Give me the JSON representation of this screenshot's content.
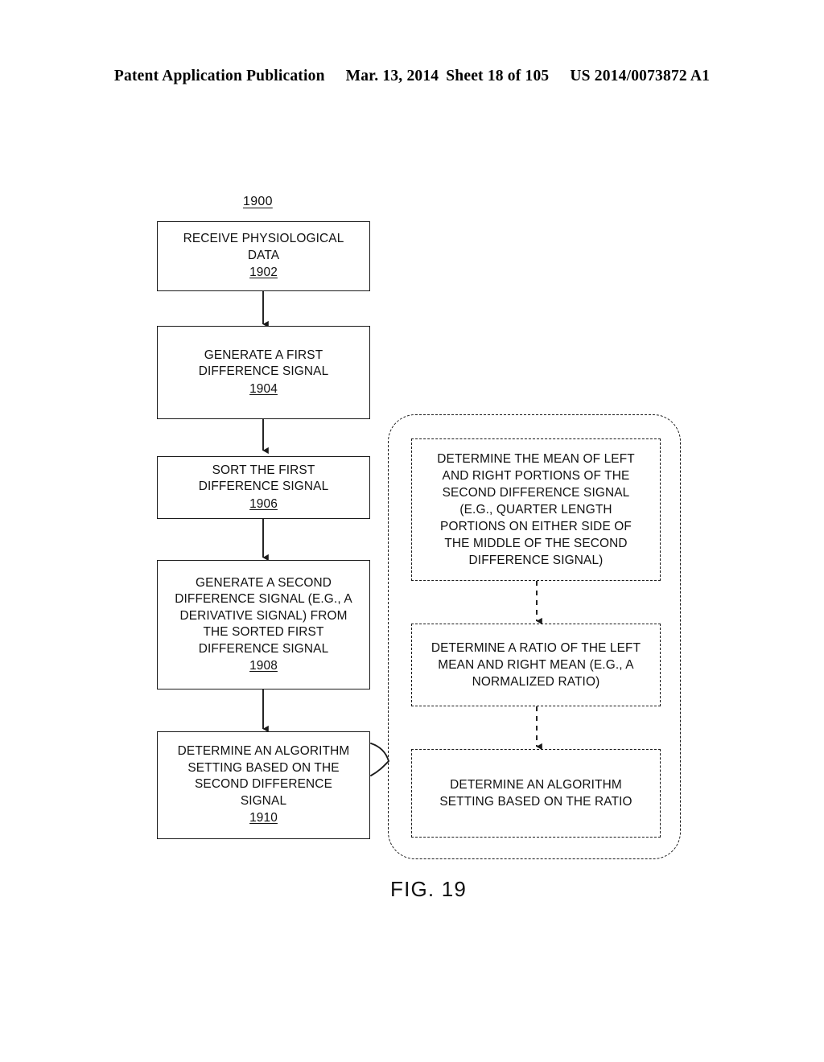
{
  "header": {
    "publication": "Patent Application Publication",
    "date": "Mar. 13, 2014",
    "sheet": "Sheet 18 of 105",
    "patent_number": "US 2014/0073872 A1"
  },
  "figure": {
    "caption": "FIG. 19",
    "diagram_ref": "1900",
    "type": "flowchart",
    "colors": {
      "line": "#1a1a1a",
      "text": "#111111",
      "background": "#ffffff"
    },
    "main_flow": [
      {
        "id": "1902",
        "text": "RECEIVE PHYSIOLOGICAL\nDATA",
        "ref": "1902"
      },
      {
        "id": "1904",
        "text": "GENERATE A FIRST\nDIFFERENCE SIGNAL",
        "ref": "1904"
      },
      {
        "id": "1906",
        "text": "SORT THE FIRST\nDIFFERENCE SIGNAL",
        "ref": "1906"
      },
      {
        "id": "1908",
        "text": "GENERATE A SECOND\nDIFFERENCE SIGNAL (E.G., A\nDERIVATIVE SIGNAL) FROM\nTHE SORTED FIRST\nDIFFERENCE SIGNAL",
        "ref": "1908"
      },
      {
        "id": "1910",
        "text": "DETERMINE AN ALGORITHM\nSETTING BASED ON THE\nSECOND DIFFERENCE\nSIGNAL",
        "ref": "1910"
      }
    ],
    "callout_flow": [
      {
        "id": "callout-1",
        "text": "DETERMINE THE MEAN OF LEFT\nAND RIGHT PORTIONS OF THE\nSECOND DIFFERENCE SIGNAL\n(E.G., QUARTER LENGTH\nPORTIONS ON EITHER SIDE OF\nTHE MIDDLE OF THE SECOND\nDIFFERENCE SIGNAL)"
      },
      {
        "id": "callout-2",
        "text": "DETERMINE A RATIO OF THE LEFT\nMEAN AND RIGHT MEAN (E.G., A\nNORMALIZED RATIO)"
      },
      {
        "id": "callout-3",
        "text": "DETERMINE AN ALGORITHM\nSETTING BASED ON THE RATIO"
      }
    ]
  }
}
